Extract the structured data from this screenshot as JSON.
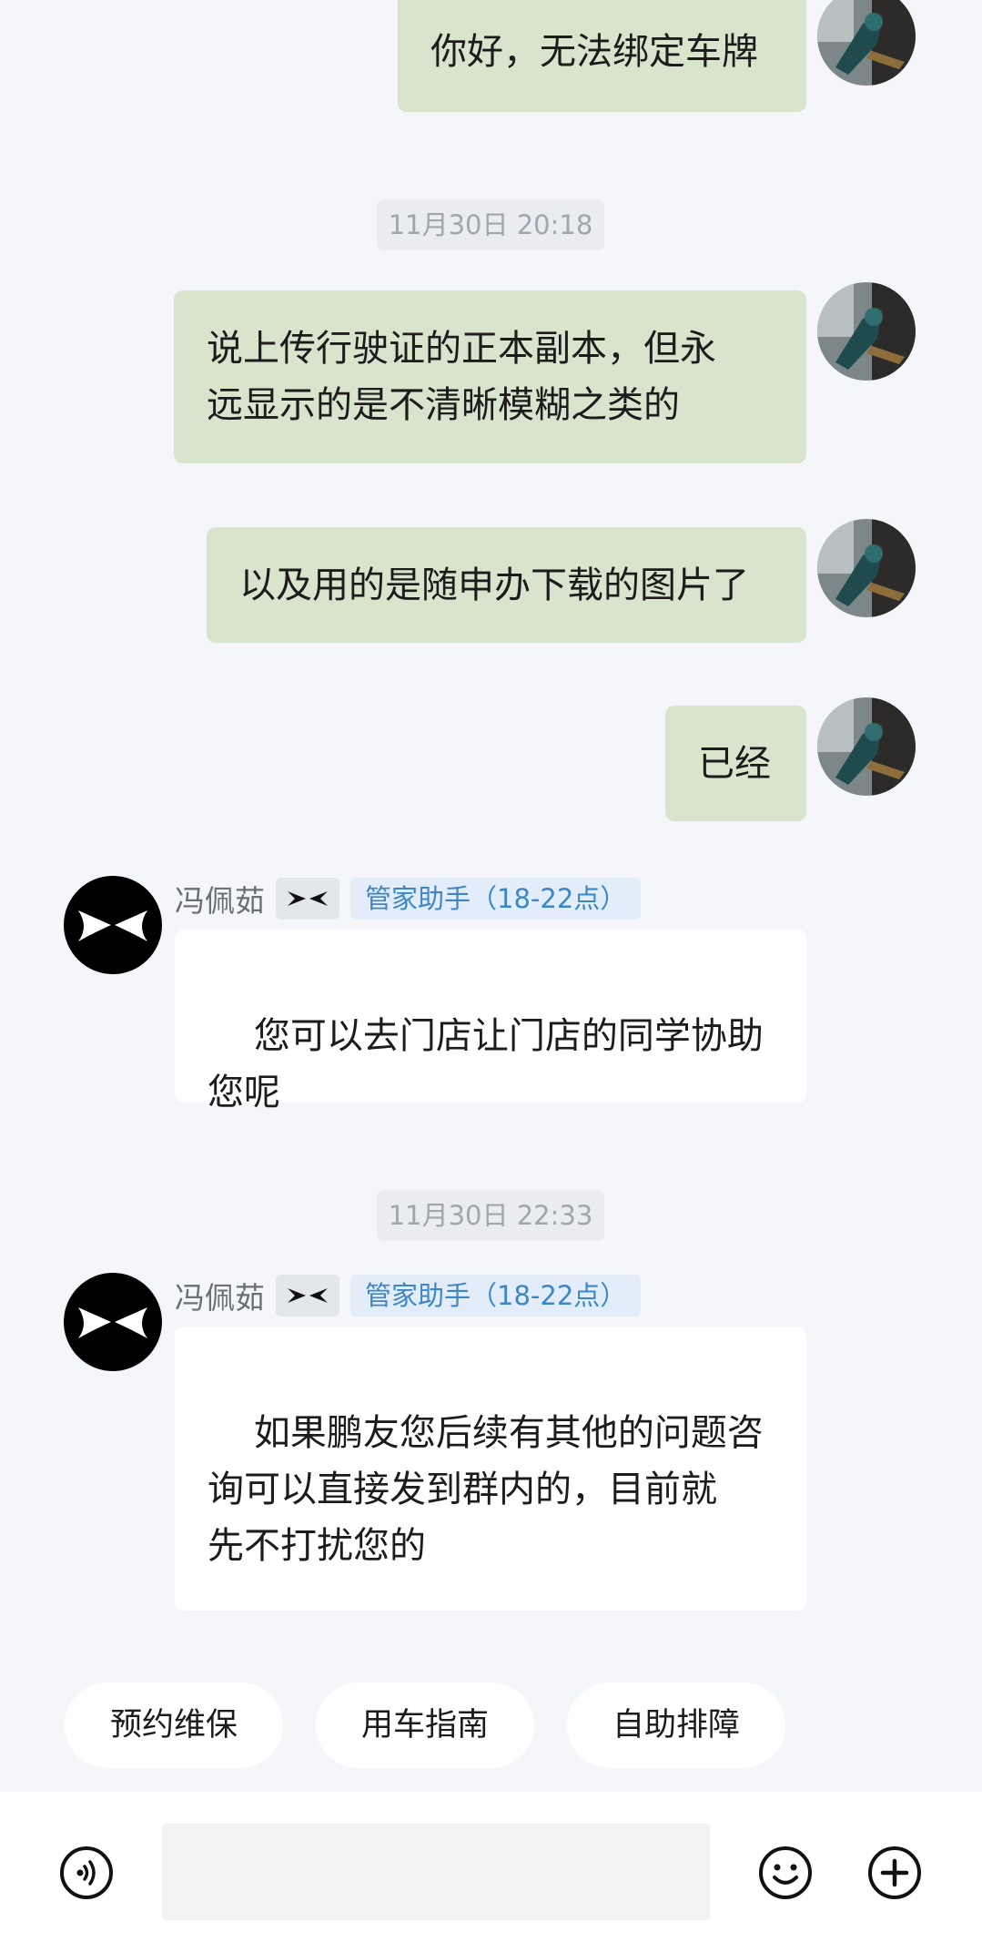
{
  "messages": {
    "m1": {
      "text": "你好，无法绑定车牌"
    },
    "ts1": "11月30日 20:18",
    "m2": {
      "text": "说上传行驶证的正本副本，但永\n远显示的是不清晰模糊之类的"
    },
    "m3": {
      "text": "以及用的是随申办下载的图片了"
    },
    "m4": {
      "text": "已经"
    },
    "m5": {
      "sender": "冯佩茹",
      "role": "管家助手（18-22点）",
      "text": "您可以去门店让门店的同学协助\n您呢"
    },
    "ts2": "11月30日 22:33",
    "m6": {
      "sender": "冯佩茹",
      "role": "管家助手（18-22点）",
      "text": "如果鹏友您后续有其他的问题咨\n询可以直接发到群内的，目前就\n先不打扰您的"
    }
  },
  "quick_actions": [
    "预约维保",
    "用车指南",
    "自助排障"
  ],
  "input": {
    "value": "",
    "placeholder": ""
  },
  "icons": {
    "voice": "voice-icon",
    "emoji": "emoji-icon",
    "plus": "plus-icon",
    "brand": "xpeng-logo-icon"
  },
  "colors": {
    "outgoing_bubble": "#d8e5cc",
    "incoming_bubble": "#ffffff",
    "background": "#f5f6fa",
    "role_tag_text": "#3d86c6"
  }
}
